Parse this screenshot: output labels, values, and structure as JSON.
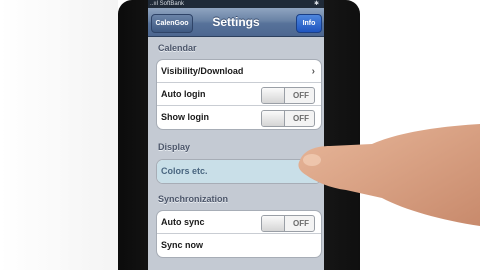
{
  "statusbar": {
    "carrier": "..ııl SoftBank",
    "bluetooth_icon": "bluetooth-icon"
  },
  "navbar": {
    "back_label": "CalenGoo",
    "title": "Settings",
    "info_label": "Info"
  },
  "sections": {
    "calendar": {
      "header": "Calendar",
      "visibility_label": "Visibility/Download",
      "auto_login_label": "Auto login",
      "auto_login_value": "OFF",
      "show_login_label": "Show login",
      "show_login_value": "OFF"
    },
    "display": {
      "header": "Display",
      "colors_label": "Colors etc."
    },
    "sync": {
      "header": "Synchronization",
      "auto_sync_label": "Auto sync",
      "auto_sync_value": "OFF",
      "sync_now_label": "Sync now"
    }
  },
  "colors": {
    "navbar": "#6a83a6",
    "info_button": "#2d63c8",
    "highlight_row": "#c9dfe8",
    "background": "#c4cad3"
  }
}
